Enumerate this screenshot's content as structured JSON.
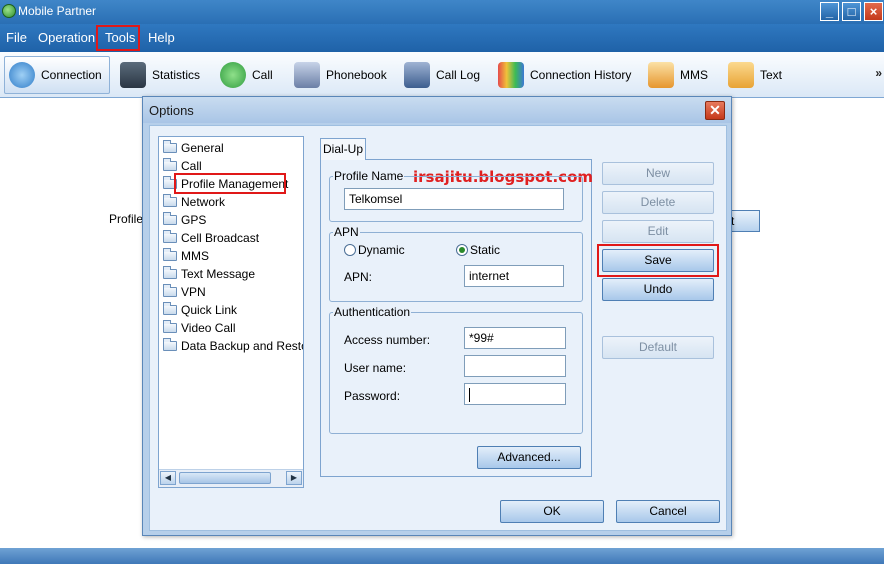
{
  "window": {
    "title": "Mobile Partner"
  },
  "menu": [
    {
      "label": "File"
    },
    {
      "label": "Operation"
    },
    {
      "label": "Tools"
    },
    {
      "label": "Help"
    }
  ],
  "toolbar": [
    {
      "label": "Connection",
      "icon": "connection-icon",
      "color": "#2f7cc8"
    },
    {
      "label": "Statistics",
      "icon": "statistics-icon",
      "color": "#3a4a5a"
    },
    {
      "label": "Call",
      "icon": "call-icon",
      "color": "#2f9c3f"
    },
    {
      "label": "Phonebook",
      "icon": "phonebook-icon",
      "color": "#6b7fa6"
    },
    {
      "label": "Call Log",
      "icon": "call-log-icon",
      "color": "#3d5e8f"
    },
    {
      "label": "Connection History",
      "icon": "connection-history-icon",
      "color": "#7a63b8"
    },
    {
      "label": "MMS",
      "icon": "mms-icon",
      "color": "#e6962e"
    },
    {
      "label": "Text",
      "icon": "text-icon",
      "color": "#e8a334"
    }
  ],
  "toolbar_more": "»",
  "background": {
    "profile_label": "Profile",
    "button_edge": "t"
  },
  "dialog": {
    "title": "Options",
    "tree": [
      "General",
      "Call",
      "Profile Management",
      "Network",
      "GPS",
      "Cell Broadcast",
      "MMS",
      "Text Message",
      "VPN",
      "Quick Link",
      "Video Call",
      "Data Backup and Restora"
    ],
    "tab": "Dial-Up",
    "watermark": "irsajitu.blogspot.com",
    "profile_name": {
      "label": "Profile Name",
      "value": "Telkomsel"
    },
    "apn": {
      "label": "APN",
      "dynamic": "Dynamic",
      "static": "Static",
      "selected": "Static",
      "field_label": "APN:",
      "value": "internet"
    },
    "auth": {
      "label": "Authentication",
      "access_label": "Access number:",
      "access_value": "*99#",
      "user_label": "User name:",
      "user_value": "",
      "pass_label": "Password:",
      "pass_value": ""
    },
    "advanced": "Advanced...",
    "side_buttons": {
      "new": "New",
      "delete": "Delete",
      "edit": "Edit",
      "save": "Save",
      "undo": "Undo",
      "default": "Default"
    },
    "ok": "OK",
    "cancel": "Cancel",
    "highlight_color": "#e01818"
  }
}
